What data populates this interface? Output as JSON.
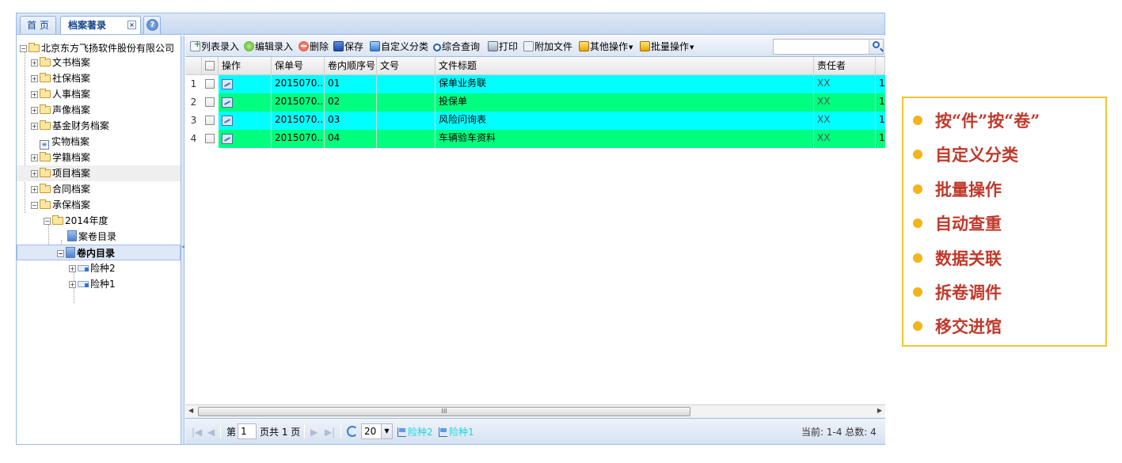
{
  "tabs": {
    "home": "首 页",
    "active": "档案著录",
    "close_glyph": "×",
    "help_glyph": "?"
  },
  "tree": {
    "root": "北京东方飞扬软件股份有限公司",
    "items": [
      "文书档案",
      "社保档案",
      "人事档案",
      "声像档案",
      "基金财务档案",
      "实物档案",
      "学籍档案",
      "项目档案",
      "合同档案",
      "承保档案"
    ],
    "year": "2014年度",
    "sub": [
      "案卷目录",
      "卷内目录"
    ],
    "leaves": [
      "险种2",
      "险种1"
    ]
  },
  "toolbar": {
    "list_entry": "列表录入",
    "edit_entry": "编辑录入",
    "delete": "删除",
    "save": "保存",
    "custom_class": "自定义分类",
    "query": "综合查询",
    "print": "打印",
    "attach": "附加文件",
    "other_ops": "其他操作",
    "batch_ops": "批量操作",
    "search_placeholder": ""
  },
  "grid": {
    "headers": [
      "操作",
      "保单号",
      "卷内顺序号",
      "文号",
      "文件标题",
      "责任者"
    ],
    "rows": [
      {
        "num": "1",
        "policy": "2015070...",
        "seq": "01",
        "docno": "",
        "title": "保单业务联",
        "owner": "XX",
        "extra": "1",
        "color": "cyan"
      },
      {
        "num": "2",
        "policy": "2015070...",
        "seq": "02",
        "docno": "",
        "title": "投保单",
        "owner": "XX",
        "extra": "1",
        "color": "green"
      },
      {
        "num": "3",
        "policy": "2015070...",
        "seq": "03",
        "docno": "",
        "title": "风险问询表",
        "owner": "XX",
        "extra": "1",
        "color": "cyan"
      },
      {
        "num": "4",
        "policy": "2015070...",
        "seq": "04",
        "docno": "",
        "title": "车辆验车资料",
        "owner": "XX",
        "extra": "1",
        "color": "green"
      }
    ],
    "scroll_glyph": "III"
  },
  "pager": {
    "page_prefix": "第",
    "page_value": "1",
    "page_suffix": "页共 1 页",
    "page_size": "20",
    "link1": "险种2",
    "link2": "险种1",
    "summary": "当前: 1-4 总数: 4"
  },
  "callout": {
    "items": [
      "按“件”按“卷”",
      "自定义分类",
      "批量操作",
      "自动查重",
      "数据关联",
      "拆卷调件",
      "移交进馆"
    ],
    "bullet_color": "#f2b51b",
    "text_color": "#c0392b",
    "border_color": "#f0c435"
  },
  "colors": {
    "row_cyan": "#00ffff",
    "row_green": "#00ff7f",
    "frame_blue": "#99bbe8"
  }
}
